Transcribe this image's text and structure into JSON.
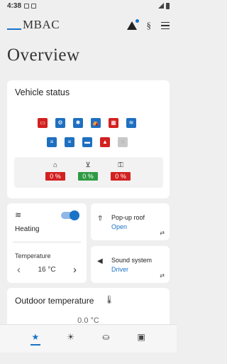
{
  "status_bar": {
    "time": "4:38"
  },
  "app_bar": {
    "brand": "MBAC",
    "legal_icon_text": "§"
  },
  "page_title": "Overview",
  "vehicle_status": {
    "title": "Vehicle status",
    "percentages": [
      "0 %",
      "0 %",
      "0 %"
    ],
    "colors": {
      "red": "#d32020",
      "blue": "#1f6fc0",
      "green": "#2f9a44"
    }
  },
  "heating": {
    "label": "Heating",
    "enabled": true,
    "temperature_label": "Temperature",
    "temperature_value": "16 °C"
  },
  "popup_roof": {
    "title": "Pop-up roof",
    "value": "Open"
  },
  "sound_system": {
    "title": "Sound system",
    "value": "Driver"
  },
  "outdoor": {
    "title": "Outdoor temperature",
    "value": "0.0 °C"
  },
  "bottom_nav": {
    "items": [
      "star-icon",
      "sun-icon",
      "sofa-icon",
      "vehicle-icon"
    ],
    "active": 0
  },
  "accent_color": "#1a73c7"
}
